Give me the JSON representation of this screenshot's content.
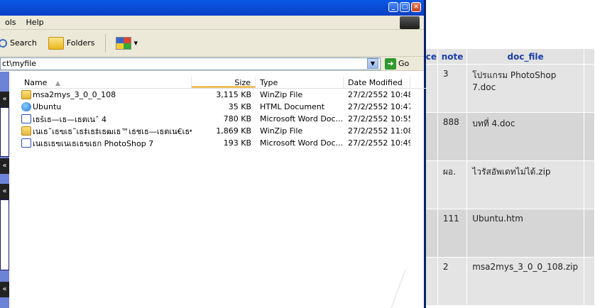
{
  "menubar": {
    "items": [
      "ols",
      "Help"
    ]
  },
  "toolbar": {
    "search_label": "Search",
    "folders_label": "Folders",
    "views_caret": "▾"
  },
  "address": {
    "value": "ct\\myfile",
    "go_label": "Go"
  },
  "left_pane": {
    "chevrons": [
      "«",
      "«",
      "«",
      "«"
    ]
  },
  "list": {
    "headers": {
      "name": "Name",
      "size": "Size",
      "type": "Type",
      "date": "Date Modified"
    },
    "sort_indicator": "▲",
    "rows": [
      {
        "icon": "winzip-file-icon",
        "name": "msa2mys_3_0_0_108",
        "size": "3,115 KB",
        "type": "WinZip File",
        "date": "27/2/2552 10:48"
      },
      {
        "icon": "html-document-icon",
        "name": "Ubuntu",
        "size": "35 KB",
        "type": "HTML Document",
        "date": "27/2/2552 10:47"
      },
      {
        "icon": "word-document-icon",
        "name": "เธšเธ—เธ—เธตเนˆ 4",
        "size": "780 KB",
        "type": "Microsoft Word Doc...",
        "date": "27/2/2552 10:55"
      },
      {
        "icon": "winzip-file-icon",
        "name": "เนเธ˜เธฃเธ˜เธ‡เธ‡เธฒเธ™เธชเธ—เธตเน€เธซเธง...",
        "size": "1,869 KB",
        "type": "WinZip File",
        "date": "27/2/2552 11:08"
      },
      {
        "icon": "word-document-icon",
        "name": "เนเธเธฃเนเธเธฃเธก PhotoShop 7",
        "size": "193 KB",
        "type": "Microsoft Word Doc...",
        "date": "27/2/2552 10:49"
      }
    ]
  },
  "table": {
    "headers": [
      "ce",
      "note",
      "doc_file",
      ""
    ],
    "rows": [
      {
        "note": "3",
        "doc_file": "โปรแกรม PhotoShop 7.doc"
      },
      {
        "note": "888",
        "doc_file": "บทที่ 4.doc"
      },
      {
        "note": "ผอ.",
        "doc_file": "ไวรัสอัพเดทไม่ได้.zip"
      },
      {
        "note": "111",
        "doc_file": "Ubuntu.htm"
      },
      {
        "note": "2",
        "doc_file": "msa2mys_3_0_0_108.zip"
      }
    ]
  },
  "colors": {
    "title_blue": "#0a3fc4",
    "header_text": "#1c3fa8",
    "toolbar_bg": "#ece9d8"
  }
}
